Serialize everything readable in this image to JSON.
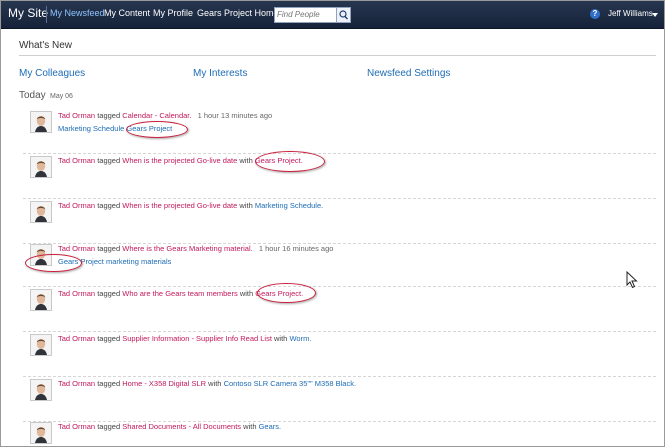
{
  "topbar": {
    "site": "My Site",
    "nav": [
      "My Newsfeed",
      "My Content",
      "My Profile",
      "Gears Project Home"
    ],
    "search_placeholder": "Find People",
    "help": "?",
    "user": "Jeff Williams"
  },
  "main": {
    "title": "What's New",
    "links": [
      "My Colleagues",
      "My Interests",
      "Newsfeed Settings"
    ],
    "today_label": "Today",
    "today_date": "May 06"
  },
  "feed": {
    "author": "Tad Orman",
    "tagged": "tagged",
    "with": "with",
    "entries": [
      {
        "target": "Calendar - Calendar.",
        "time": "1 hour 13 minutes ago",
        "line2": [
          "Marketing Schedule",
          "Gears Project"
        ]
      },
      {
        "target": "When is the projected Go-live date",
        "tag": "Gears Project."
      },
      {
        "target": "When is the projected Go-live date",
        "tag": "Marketing Schedule."
      },
      {
        "target": "Where is the Gears Marketing material.",
        "time": "1 hour 16 minutes ago",
        "line2": [
          "Gears Project",
          "marketing materials"
        ]
      },
      {
        "target": "Who are the Gears team members",
        "tag": "Gears Project."
      },
      {
        "target": "Supplier Information - Supplier Info Read List",
        "tag": "Worm."
      },
      {
        "target": "Home - X358 Digital SLR",
        "tag": "Contoso SLR Camera 35\"\" M358 Black."
      },
      {
        "target": "Shared Documents - All Documents",
        "tag": "Gears."
      }
    ]
  },
  "colors": {
    "topbar": "#1b2943",
    "link": "#1d6cb5",
    "tag_link": "#c2185b",
    "annotation": "#c7203c"
  },
  "icons": [
    "search-icon",
    "help-icon",
    "chevron-down-icon",
    "avatar",
    "cursor-icon"
  ]
}
